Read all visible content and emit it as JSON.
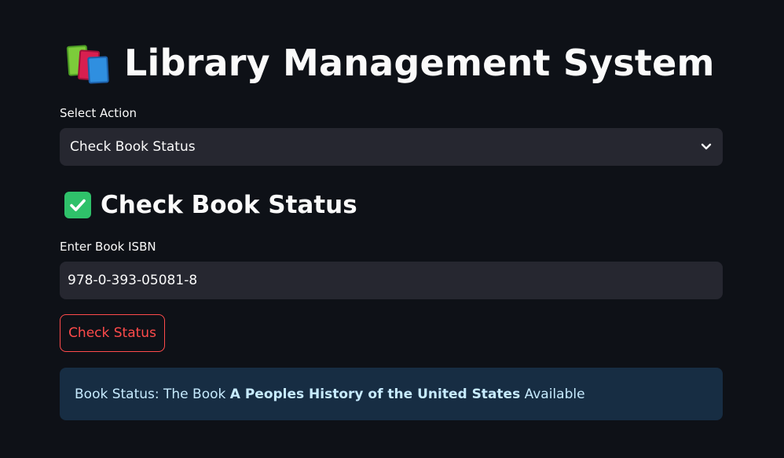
{
  "page": {
    "title": "Library Management System",
    "title_icon": "books-icon"
  },
  "action_select": {
    "label": "Select Action",
    "selected": "Check Book Status",
    "icon": "chevron-down-icon"
  },
  "section": {
    "title": "Check Book Status",
    "icon": "check-mark-icon"
  },
  "isbn_input": {
    "label": "Enter Book ISBN",
    "value": "978-0-393-05081-8"
  },
  "check_button": {
    "label": "Check Status"
  },
  "status_alert": {
    "prefix": "Book Status: The Book ",
    "book_title": "A Peoples History of the United States",
    "suffix": " Available"
  },
  "colors": {
    "background": "#0e1117",
    "accent": "#ff4b4b",
    "input_bg": "#262730",
    "info_bg": "#172d43",
    "info_text": "#c7ebff",
    "success": "#2fc16a"
  }
}
